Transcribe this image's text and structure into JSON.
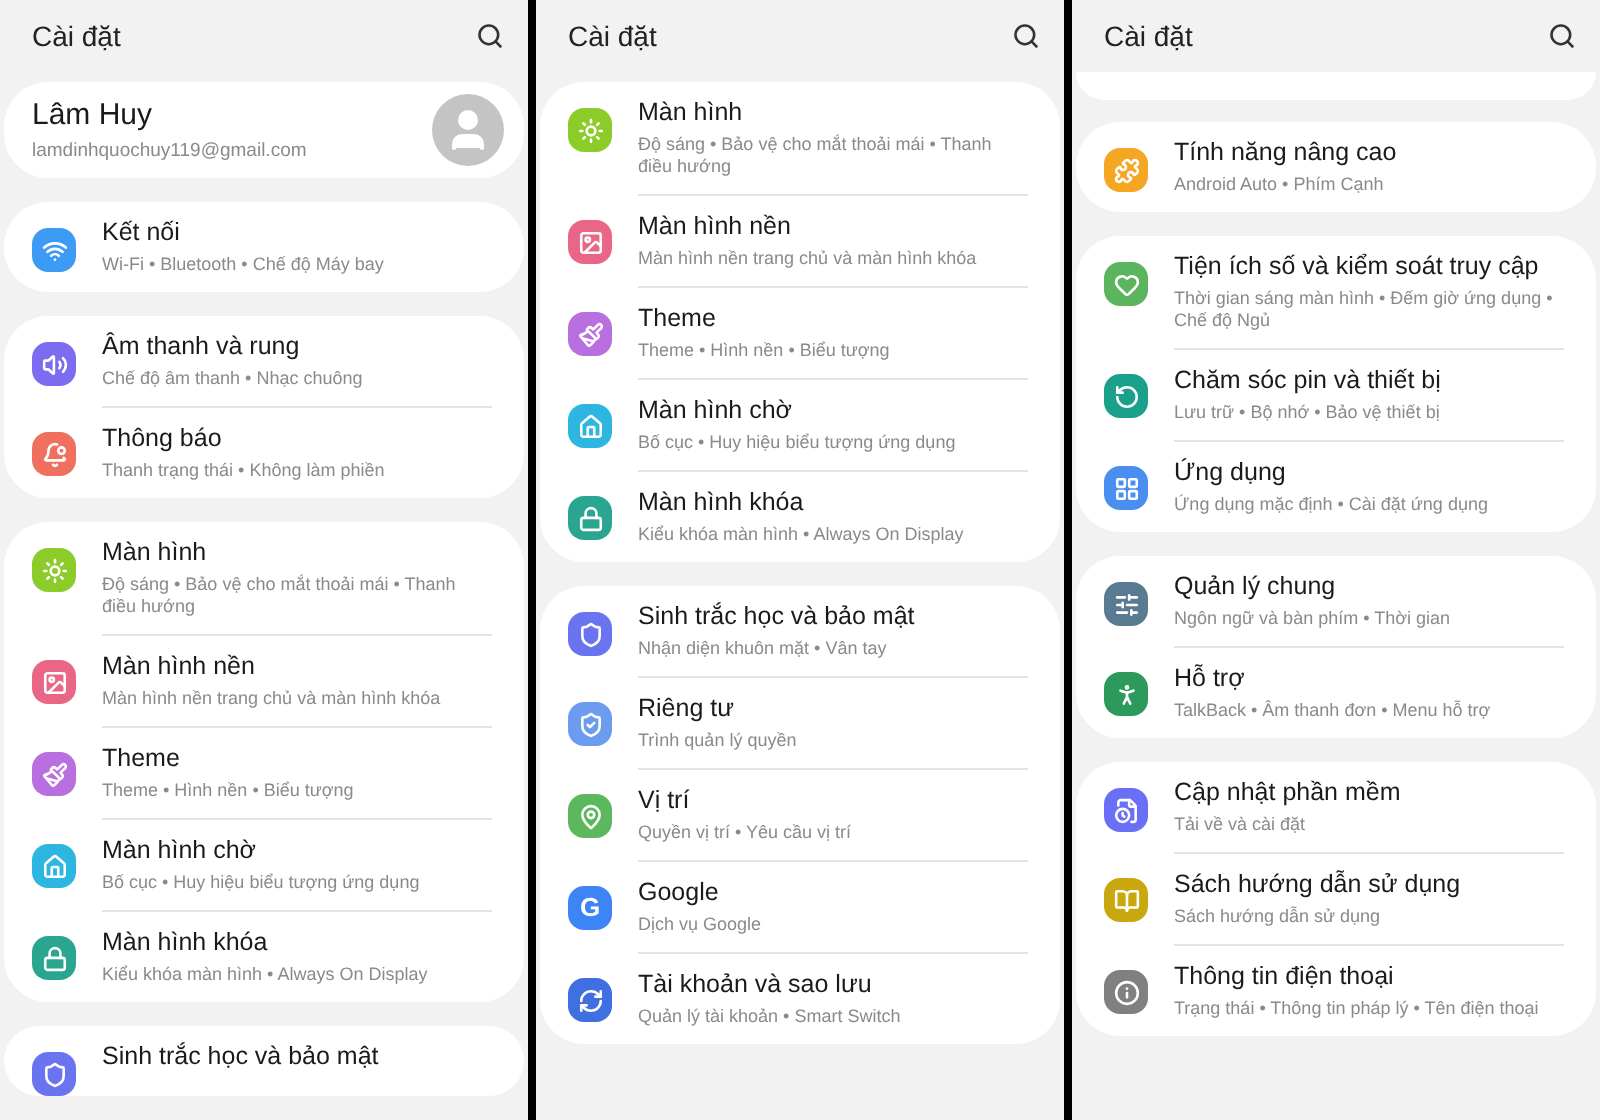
{
  "panels": [
    {
      "title": "Cài đặt",
      "clipped_top": false,
      "profile": {
        "name": "Lâm Huy",
        "email": "lamdinhquochuy119@gmail.com"
      },
      "groups": [
        [
          {
            "kind": "wifi",
            "color": "#3e9bf5",
            "title": "Kết nối",
            "subtitle": "Wi-Fi  •  Bluetooth  •  Chế độ Máy bay"
          }
        ],
        [
          {
            "kind": "sound",
            "color": "#7b6cf0",
            "title": "Âm thanh và rung",
            "subtitle": "Chế độ âm thanh  •  Nhạc chuông"
          },
          {
            "kind": "notification",
            "color": "#f0705f",
            "title": "Thông báo",
            "subtitle": "Thanh trạng thái  •  Không làm phiền"
          }
        ],
        [
          {
            "kind": "sun",
            "color": "#8ccc2a",
            "title": "Màn hình",
            "subtitle": "Độ sáng  •  Bảo vệ cho mắt thoải mái  •  Thanh điều hướng"
          },
          {
            "kind": "image",
            "color": "#ea6686",
            "title": "Màn hình nền",
            "subtitle": "Màn hình nền trang chủ và màn hình khóa"
          },
          {
            "kind": "brush",
            "color": "#b96fe0",
            "title": "Theme",
            "subtitle": "Theme  •  Hình nền  •  Biểu tượng"
          },
          {
            "kind": "home",
            "color": "#2cb6e0",
            "title": "Màn hình chờ",
            "subtitle": "Bố cục  •  Huy hiệu biểu tượng ứng dụng"
          },
          {
            "kind": "lock",
            "color": "#2aa58f",
            "title": "Màn hình khóa",
            "subtitle": "Kiểu khóa màn hình  •  Always On Display"
          }
        ],
        [
          {
            "kind": "shield",
            "color": "#6a74f0",
            "title": "Sinh trắc học và bảo mật"
          }
        ]
      ]
    },
    {
      "title": "Cài đặt",
      "clipped_top": false,
      "groups": [
        [
          {
            "kind": "sun",
            "color": "#8ccc2a",
            "title": "Màn hình",
            "subtitle": "Độ sáng  •  Bảo vệ cho mắt thoải mái  •  Thanh điều hướng"
          },
          {
            "kind": "image",
            "color": "#ea6686",
            "title": "Màn hình nền",
            "subtitle": "Màn hình nền trang chủ và màn hình khóa"
          },
          {
            "kind": "brush",
            "color": "#b96fe0",
            "title": "Theme",
            "subtitle": "Theme  •  Hình nền  •  Biểu tượng"
          },
          {
            "kind": "home",
            "color": "#2cb6e0",
            "title": "Màn hình chờ",
            "subtitle": "Bố cục  •  Huy hiệu biểu tượng ứng dụng"
          },
          {
            "kind": "lock",
            "color": "#2aa58f",
            "title": "Màn hình khóa",
            "subtitle": "Kiểu khóa màn hình  •  Always On Display"
          }
        ],
        [
          {
            "kind": "shield",
            "color": "#6a74f0",
            "title": "Sinh trắc học và bảo mật",
            "subtitle": "Nhận diện khuôn mặt  •  Vân tay"
          },
          {
            "kind": "privacy",
            "color": "#6c9cf0",
            "title": "Riêng tư",
            "subtitle": "Trình quản lý quyền"
          },
          {
            "kind": "pin",
            "color": "#5cb85c",
            "title": "Vị trí",
            "subtitle": "Quyền vị trí  •  Yêu cầu vị trí"
          },
          {
            "kind": "glyph",
            "glyph": "G",
            "color": "#3d84f5",
            "title": "Google",
            "subtitle": "Dịch vụ Google"
          },
          {
            "kind": "sync",
            "color": "#3f6fe0",
            "title": "Tài khoản và sao lưu",
            "subtitle": "Quản lý tài khoản  •  Smart Switch"
          }
        ]
      ]
    },
    {
      "title": "Cài đặt",
      "clipped_top": true,
      "groups": [
        [
          {
            "kind": "puzzle",
            "color": "#f5a623",
            "title": "Tính năng nâng cao",
            "subtitle": "Android Auto  •  Phím Cạnh"
          }
        ],
        [
          {
            "kind": "heart",
            "color": "#5ab55e",
            "title": "Tiện ích số và kiểm soát truy cập",
            "subtitle": "Thời gian sáng màn hình  •  Đếm giờ ứng dụng  •  Chế độ Ngủ"
          },
          {
            "kind": "care",
            "color": "#1aa08b",
            "title": "Chăm sóc pin và thiết bị",
            "subtitle": "Lưu trữ  •  Bộ nhớ  •  Bảo vệ thiết bị"
          },
          {
            "kind": "grid",
            "color": "#4a8ef0",
            "title": "Ứng dụng",
            "subtitle": "Ứng dụng mặc định  •  Cài đặt ứng dụng"
          }
        ],
        [
          {
            "kind": "sliders",
            "color": "#587b92",
            "title": "Quản lý chung",
            "subtitle": "Ngôn ngữ và bàn phím  •  Thời gian"
          },
          {
            "kind": "person",
            "color": "#2b9a5a",
            "title": "Hỗ trợ",
            "subtitle": "TalkBack  •  Âm thanh đơn  •  Menu hỗ trợ"
          }
        ],
        [
          {
            "kind": "update",
            "color": "#6a70f5",
            "title": "Cập nhật phần mềm",
            "subtitle": "Tải về và cài đặt"
          },
          {
            "kind": "book",
            "color": "#c8a80e",
            "title": "Sách hướng dẫn sử dụng",
            "subtitle": "Sách hướng dẫn sử dụng"
          },
          {
            "kind": "info",
            "color": "#808080",
            "title": "Thông tin điện thoại",
            "subtitle": "Trạng thái  •  Thông tin pháp lý  •  Tên điện thoại"
          }
        ]
      ]
    }
  ]
}
